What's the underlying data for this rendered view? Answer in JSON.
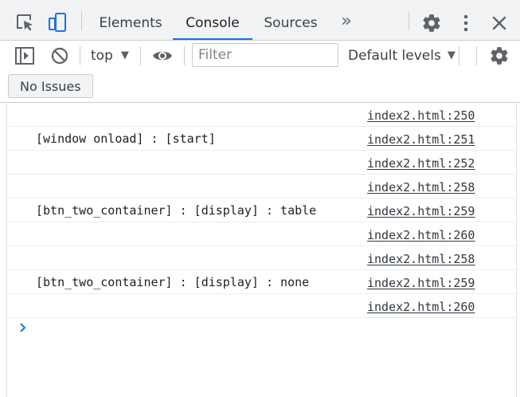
{
  "tabs": [
    {
      "label": "Elements",
      "active": false
    },
    {
      "label": "Console",
      "active": true
    },
    {
      "label": "Sources",
      "active": false
    }
  ],
  "tabbar_icons": {
    "inspect": "inspect-element-icon",
    "device": "device-toolbar-icon",
    "more_tabs": "»",
    "settings": "gear-icon",
    "menu": "kebab-menu-icon",
    "close": "close-icon"
  },
  "toolbar": {
    "context": "top",
    "filter_placeholder": "Filter",
    "filter_value": "",
    "levels": "Default levels"
  },
  "issues": {
    "label": "No Issues"
  },
  "messages": [
    {
      "text": "",
      "source": "index2.html:250"
    },
    {
      "text": "[window onload] : [start]",
      "source": "index2.html:251"
    },
    {
      "text": "",
      "source": "index2.html:252"
    },
    {
      "text": "",
      "source": "index2.html:258"
    },
    {
      "text": "[btn_two_container] : [display] : table",
      "source": "index2.html:259"
    },
    {
      "text": "",
      "source": "index2.html:260"
    },
    {
      "text": "",
      "source": "index2.html:258"
    },
    {
      "text": "[btn_two_container] : [display] : none",
      "source": "index2.html:259"
    },
    {
      "text": "",
      "source": "index2.html:260"
    }
  ],
  "colors": {
    "accent": "#1a73e8",
    "toolbar_bg": "#f1f3f4",
    "border": "#cbcdd1"
  }
}
